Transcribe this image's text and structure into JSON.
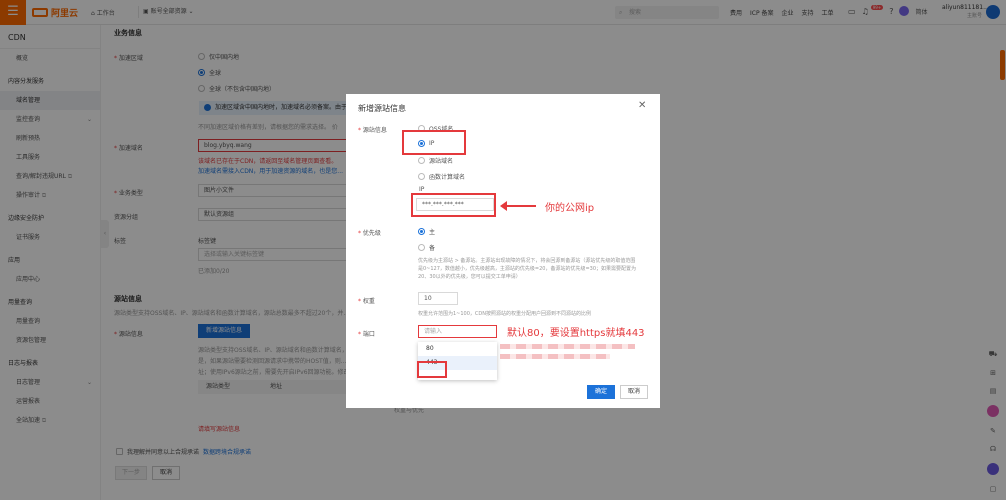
{
  "topbar": {
    "menu_icon": "☰",
    "brand": "阿里云",
    "workbench": "工作台",
    "resource_group": "账号全部资源",
    "search_placeholder": "搜索",
    "links": [
      "费用",
      "ICP 备案",
      "企业",
      "支持",
      "工单"
    ],
    "badge": "99+",
    "lang": "简体",
    "username": "aliyun811181...",
    "user_role": "主账号"
  },
  "sidebar": {
    "title": "CDN",
    "items": [
      {
        "label": "概览",
        "type": "item"
      },
      {
        "label": "内容分发服务",
        "type": "group"
      },
      {
        "label": "域名管理",
        "type": "item",
        "active": true
      },
      {
        "label": "监控查询",
        "type": "item",
        "chevron": true
      },
      {
        "label": "刷新预热",
        "type": "item"
      },
      {
        "label": "工具服务",
        "type": "item"
      },
      {
        "label": "查询/解封违规URL",
        "type": "item",
        "ext": true
      },
      {
        "label": "操作审计",
        "type": "item",
        "ext": true
      },
      {
        "label": "边缘安全防护",
        "type": "group"
      },
      {
        "label": "证书服务",
        "type": "item"
      },
      {
        "label": "应用",
        "type": "group"
      },
      {
        "label": "应用中心",
        "type": "item"
      },
      {
        "label": "用量查询",
        "type": "group"
      },
      {
        "label": "用量查询",
        "type": "item"
      },
      {
        "label": "资源包管理",
        "type": "item"
      },
      {
        "label": "日志与报表",
        "type": "group"
      },
      {
        "label": "日志管理",
        "type": "item",
        "chevron": true
      },
      {
        "label": "运营报表",
        "type": "item"
      },
      {
        "label": "全站加速",
        "type": "item",
        "ext": true
      }
    ]
  },
  "form": {
    "section_business": "业务信息",
    "accel_region_label": "加速区域",
    "region_options": [
      "仅中国内地",
      "全球",
      "全球（不包含中国内地）"
    ],
    "region_selected": 1,
    "notice": "加速区域含中国内地时，加速域名必须备案。由于...",
    "notice_sub": "不同加速区域价格有差别，请根据您的需求选择。 价",
    "domain_label": "加速域名",
    "domain_value": "blog.ybyq.wang",
    "domain_error": "该域名已存在于CDN，请返回至域名管理页面查看。",
    "domain_hint": "加速域名需接入CDN，用于加速资源的域名，也是您...",
    "biz_type_label": "业务类型",
    "biz_type_value": "图片小文件",
    "res_group_label": "资源分组",
    "res_group_value": "默认资源组",
    "tag_label": "标签",
    "tag_key_label": "标签键",
    "tag_placeholder": "选择或输入关键标签键",
    "tag_count": "已添加0/20",
    "section_origin": "源站信息",
    "origin_desc": "源站类型支持OSS域名、IP、源站域名和函数计算域名，源站总数最多不超过20个，并...",
    "origin_label": "源站信息",
    "add_origin": "新增源站信息",
    "origin_note_1": "源站类型支持OSS域名、IP、源站域名和函数计算域名，...",
    "origin_note_2": "是，如果源站需要检测回源请求中携带的HOST值，则...",
    "origin_note_3": "址；使用IPv6源站之前，需要先开启IPv6回源功能。修改...",
    "table_cols": [
      "源站类型",
      "地址"
    ],
    "origin_error": "请填写源站信息",
    "agree": "我理解并同意以上合规承诺",
    "agree_link": "数据跨境合规承诺",
    "next": "下一步",
    "cancel": "取消",
    "weight_info": "权重与优先"
  },
  "modal": {
    "title": "新增源站信息",
    "close": "✕",
    "origin_label": "源站信息",
    "types": [
      "OSS域名",
      "IP",
      "源站域名",
      "函数计算域名"
    ],
    "type_selected": 1,
    "ip_label": "IP",
    "ip_value": "***.***.***.***",
    "priority_label": "优先级",
    "priority_opts": [
      "主",
      "备"
    ],
    "priority_selected": 0,
    "priority_desc": "优先级为主源站 > 备源站。主源站出现故障的情况下，将会回源到备源站（源站优先级的取值范围是0~127，数值越小，优先级越高，主源站的优先级=20，备源站的优先级=30；如果需要配置为20、30以外的优先级，您可以提交工单申请）",
    "weight_label": "权重",
    "weight_value": "10",
    "weight_desc": "权重允许范围为1~100，CDN按照源站的权重分配用户回源到不同源站的比例",
    "port_label": "端口",
    "port_placeholder": "请输入",
    "port_options": [
      "80",
      "443"
    ],
    "confirm": "确定",
    "cancel": "取消"
  },
  "annotations": {
    "ip_note": "你的公网ip",
    "port_note": "默认80，要设置https就填443"
  }
}
